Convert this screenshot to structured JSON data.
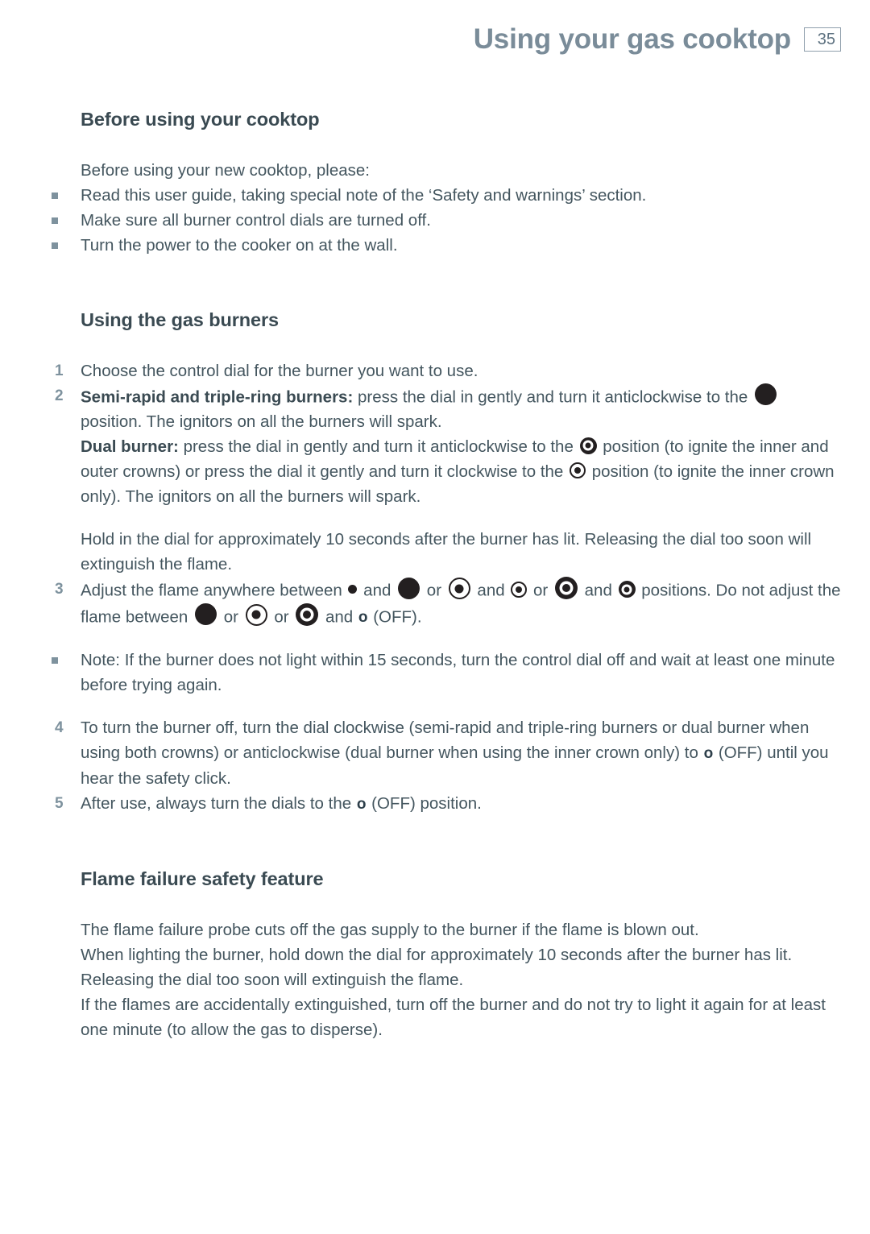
{
  "header": {
    "title": "Using your gas cooktop",
    "page_number": "35"
  },
  "colors": {
    "header_title": "#7a8c99",
    "body_text": "#44565f",
    "heading_text": "#3a4a52",
    "marker": "#7e929e",
    "symbol_black": "#231f20",
    "page_box_border": "#8f9fac"
  },
  "sections": {
    "before_using": {
      "heading": "Before using your cooktop",
      "intro": "Before using your new cooktop, please:",
      "bullets": [
        "Read this user guide, taking special note of the ‘Safety and warnings’ section.",
        "Make sure all burner control dials are turned off.",
        "Turn the power to the cooker on at the wall."
      ]
    },
    "using_burners": {
      "heading": "Using the gas burners",
      "item1": {
        "number": "1",
        "text": "Choose the control dial for the burner you want to use."
      },
      "item2": {
        "number": "2",
        "semi_rapid_label": "Semi-rapid and triple-ring burners:",
        "semi_rapid_text_a": " press the dial in gently and turn it anticlockwise to the ",
        "semi_rapid_text_b": "position. The ignitors on all the burners will spark.",
        "dual_label": "Dual burner:",
        "dual_text_a": " press the dial in gently and turn it anticlockwise to the ",
        "dual_text_b": " position (to ignite the inner and outer crowns) or press the dial it gently and turn it clockwise to the ",
        "dual_text_c": " position (to ignite the inner crown only). The ignitors on all the burners will spark.",
        "hold_text": "Hold in the dial for approximately 10 seconds after the burner has lit. Releasing the dial too soon will extinguish the flame."
      },
      "item3": {
        "number": "3",
        "text_a": "Adjust the flame anywhere between ",
        "and_1": " and ",
        "or_1": " or ",
        "and_2": " and ",
        "or_2": " or ",
        "and_3": " and ",
        "text_b": " positions. Do not adjust the flame between ",
        "or_3": " or ",
        "or_4": " or ",
        "and_4": " and ",
        "off_glyph": "o",
        "text_c": " (OFF)."
      },
      "note_bullet": "Note: If the burner does not light within 15 seconds, turn the control dial off and wait at least one minute before trying again.",
      "item4": {
        "number": "4",
        "text_a": "To turn the burner off, turn the dial clockwise (semi-rapid and triple-ring burners or dual burner when using both crowns) or anticlockwise (dual burner when using the inner crown only) to ",
        "off_glyph": "o",
        "text_b": " (OFF) until you hear the safety click."
      },
      "item5": {
        "number": "5",
        "text_a": "After use, always turn the dials to the ",
        "off_glyph": "o",
        "text_b": " (OFF) position."
      }
    },
    "flame_failure": {
      "heading": "Flame failure safety feature",
      "paragraphs": [
        "The flame failure probe cuts off the gas supply to the burner if the flame is blown out.",
        "When lighting the burner, hold down the dial for approximately 10 seconds after the burner has lit. Releasing the dial too soon will extinguish the flame.",
        "If the flames are accidentally extinguished, turn off the burner and do not try to light it again for at least one minute (to allow the gas to disperse)."
      ]
    }
  }
}
